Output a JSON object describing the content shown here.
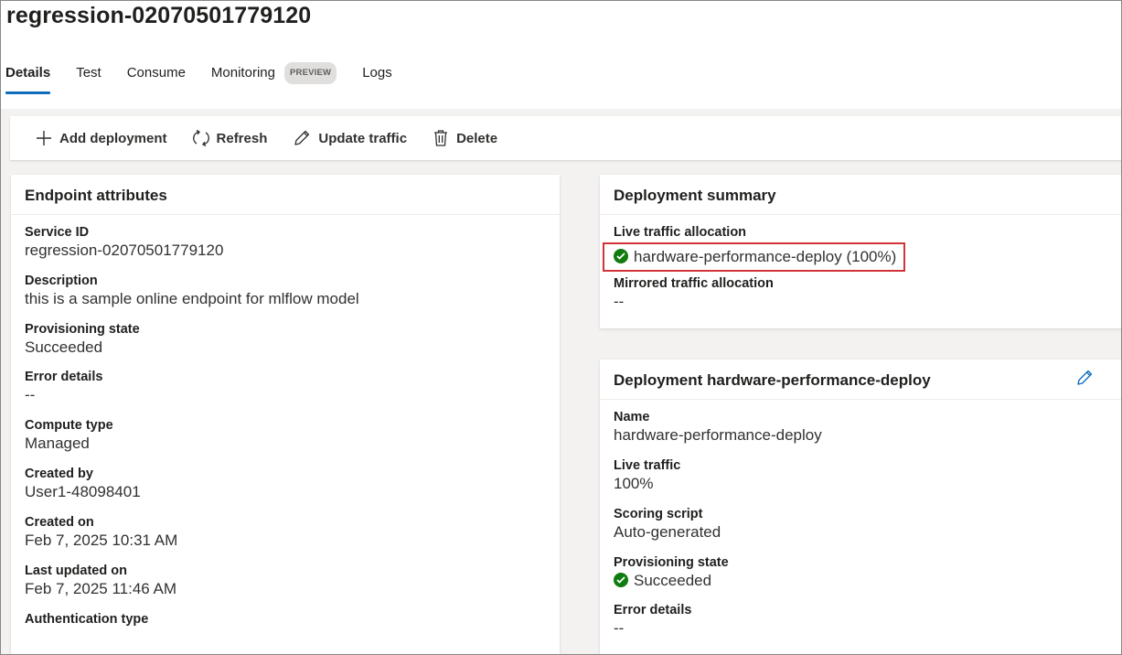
{
  "header": {
    "title": "regression-02070501779120",
    "tabs": [
      {
        "label": "Details",
        "active": true
      },
      {
        "label": "Test"
      },
      {
        "label": "Consume"
      },
      {
        "label": "Monitoring",
        "badge": "PREVIEW"
      },
      {
        "label": "Logs"
      }
    ]
  },
  "toolbar": {
    "add_deployment": "Add deployment",
    "refresh": "Refresh",
    "update_traffic": "Update traffic",
    "delete": "Delete"
  },
  "endpoint_attributes": {
    "title": "Endpoint attributes",
    "fields": [
      {
        "label": "Service ID",
        "value": "regression-02070501779120"
      },
      {
        "label": "Description",
        "value": "this is a sample online endpoint for mlflow model"
      },
      {
        "label": "Provisioning state",
        "value": "Succeeded"
      },
      {
        "label": "Error details",
        "value": "--"
      },
      {
        "label": "Compute type",
        "value": "Managed"
      },
      {
        "label": "Created by",
        "value": "User1-48098401"
      },
      {
        "label": "Created on",
        "value": "Feb 7, 2025 10:31 AM"
      },
      {
        "label": "Last updated on",
        "value": "Feb 7, 2025 11:46 AM"
      },
      {
        "label": "Authentication type",
        "value": ""
      }
    ]
  },
  "deployment_summary": {
    "title": "Deployment summary",
    "live_traffic_label": "Live traffic allocation",
    "live_traffic_value": "hardware-performance-deploy (100%)",
    "mirrored_label": "Mirrored traffic allocation",
    "mirrored_value": "--"
  },
  "deployment": {
    "title": "Deployment hardware-performance-deploy",
    "fields": [
      {
        "label": "Name",
        "value": "hardware-performance-deploy"
      },
      {
        "label": "Live traffic",
        "value": "100%"
      },
      {
        "label": "Scoring script",
        "value": "Auto-generated"
      },
      {
        "label": "Provisioning state",
        "value": "Succeeded"
      },
      {
        "label": "Error details",
        "value": "--"
      }
    ]
  },
  "colors": {
    "accent": "#0f6cbd",
    "success": "#107c10",
    "highlight_box": "#d13438"
  }
}
